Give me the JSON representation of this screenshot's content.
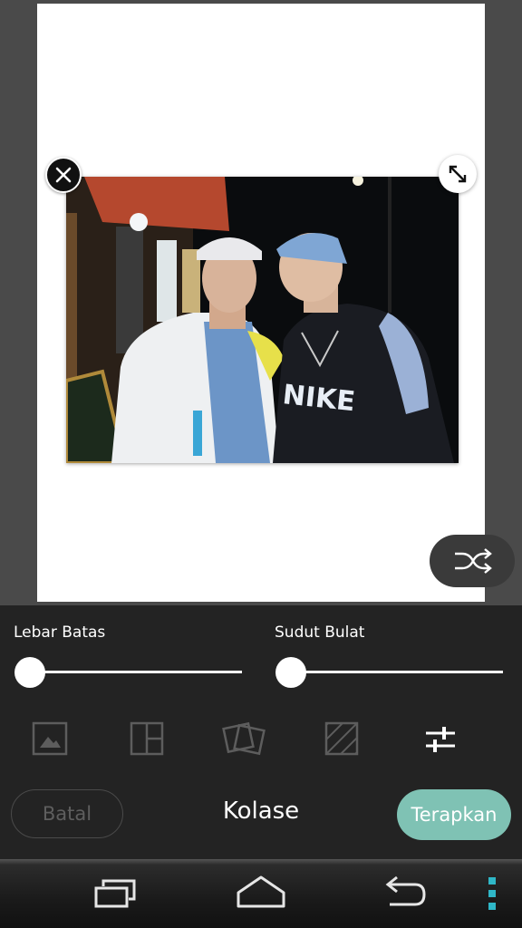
{
  "panel": {
    "border_width_label": "Lebar Batas",
    "corner_label": "Sudut Bulat",
    "border_width_value": 0,
    "corner_value": 0
  },
  "tools": [
    {
      "icon": "background-image-icon"
    },
    {
      "icon": "layout-grid-icon"
    },
    {
      "icon": "freestyle-tilt-icon"
    },
    {
      "icon": "pattern-hatch-icon"
    },
    {
      "icon": "adjust-sliders-icon"
    }
  ],
  "footer": {
    "cancel_label": "Batal",
    "title": "Kolase",
    "apply_label": "Terapkan"
  },
  "colors": {
    "accent": "#7fc2b4",
    "panel_bg": "#232323",
    "canvas_bg": "#4a4a4a"
  }
}
